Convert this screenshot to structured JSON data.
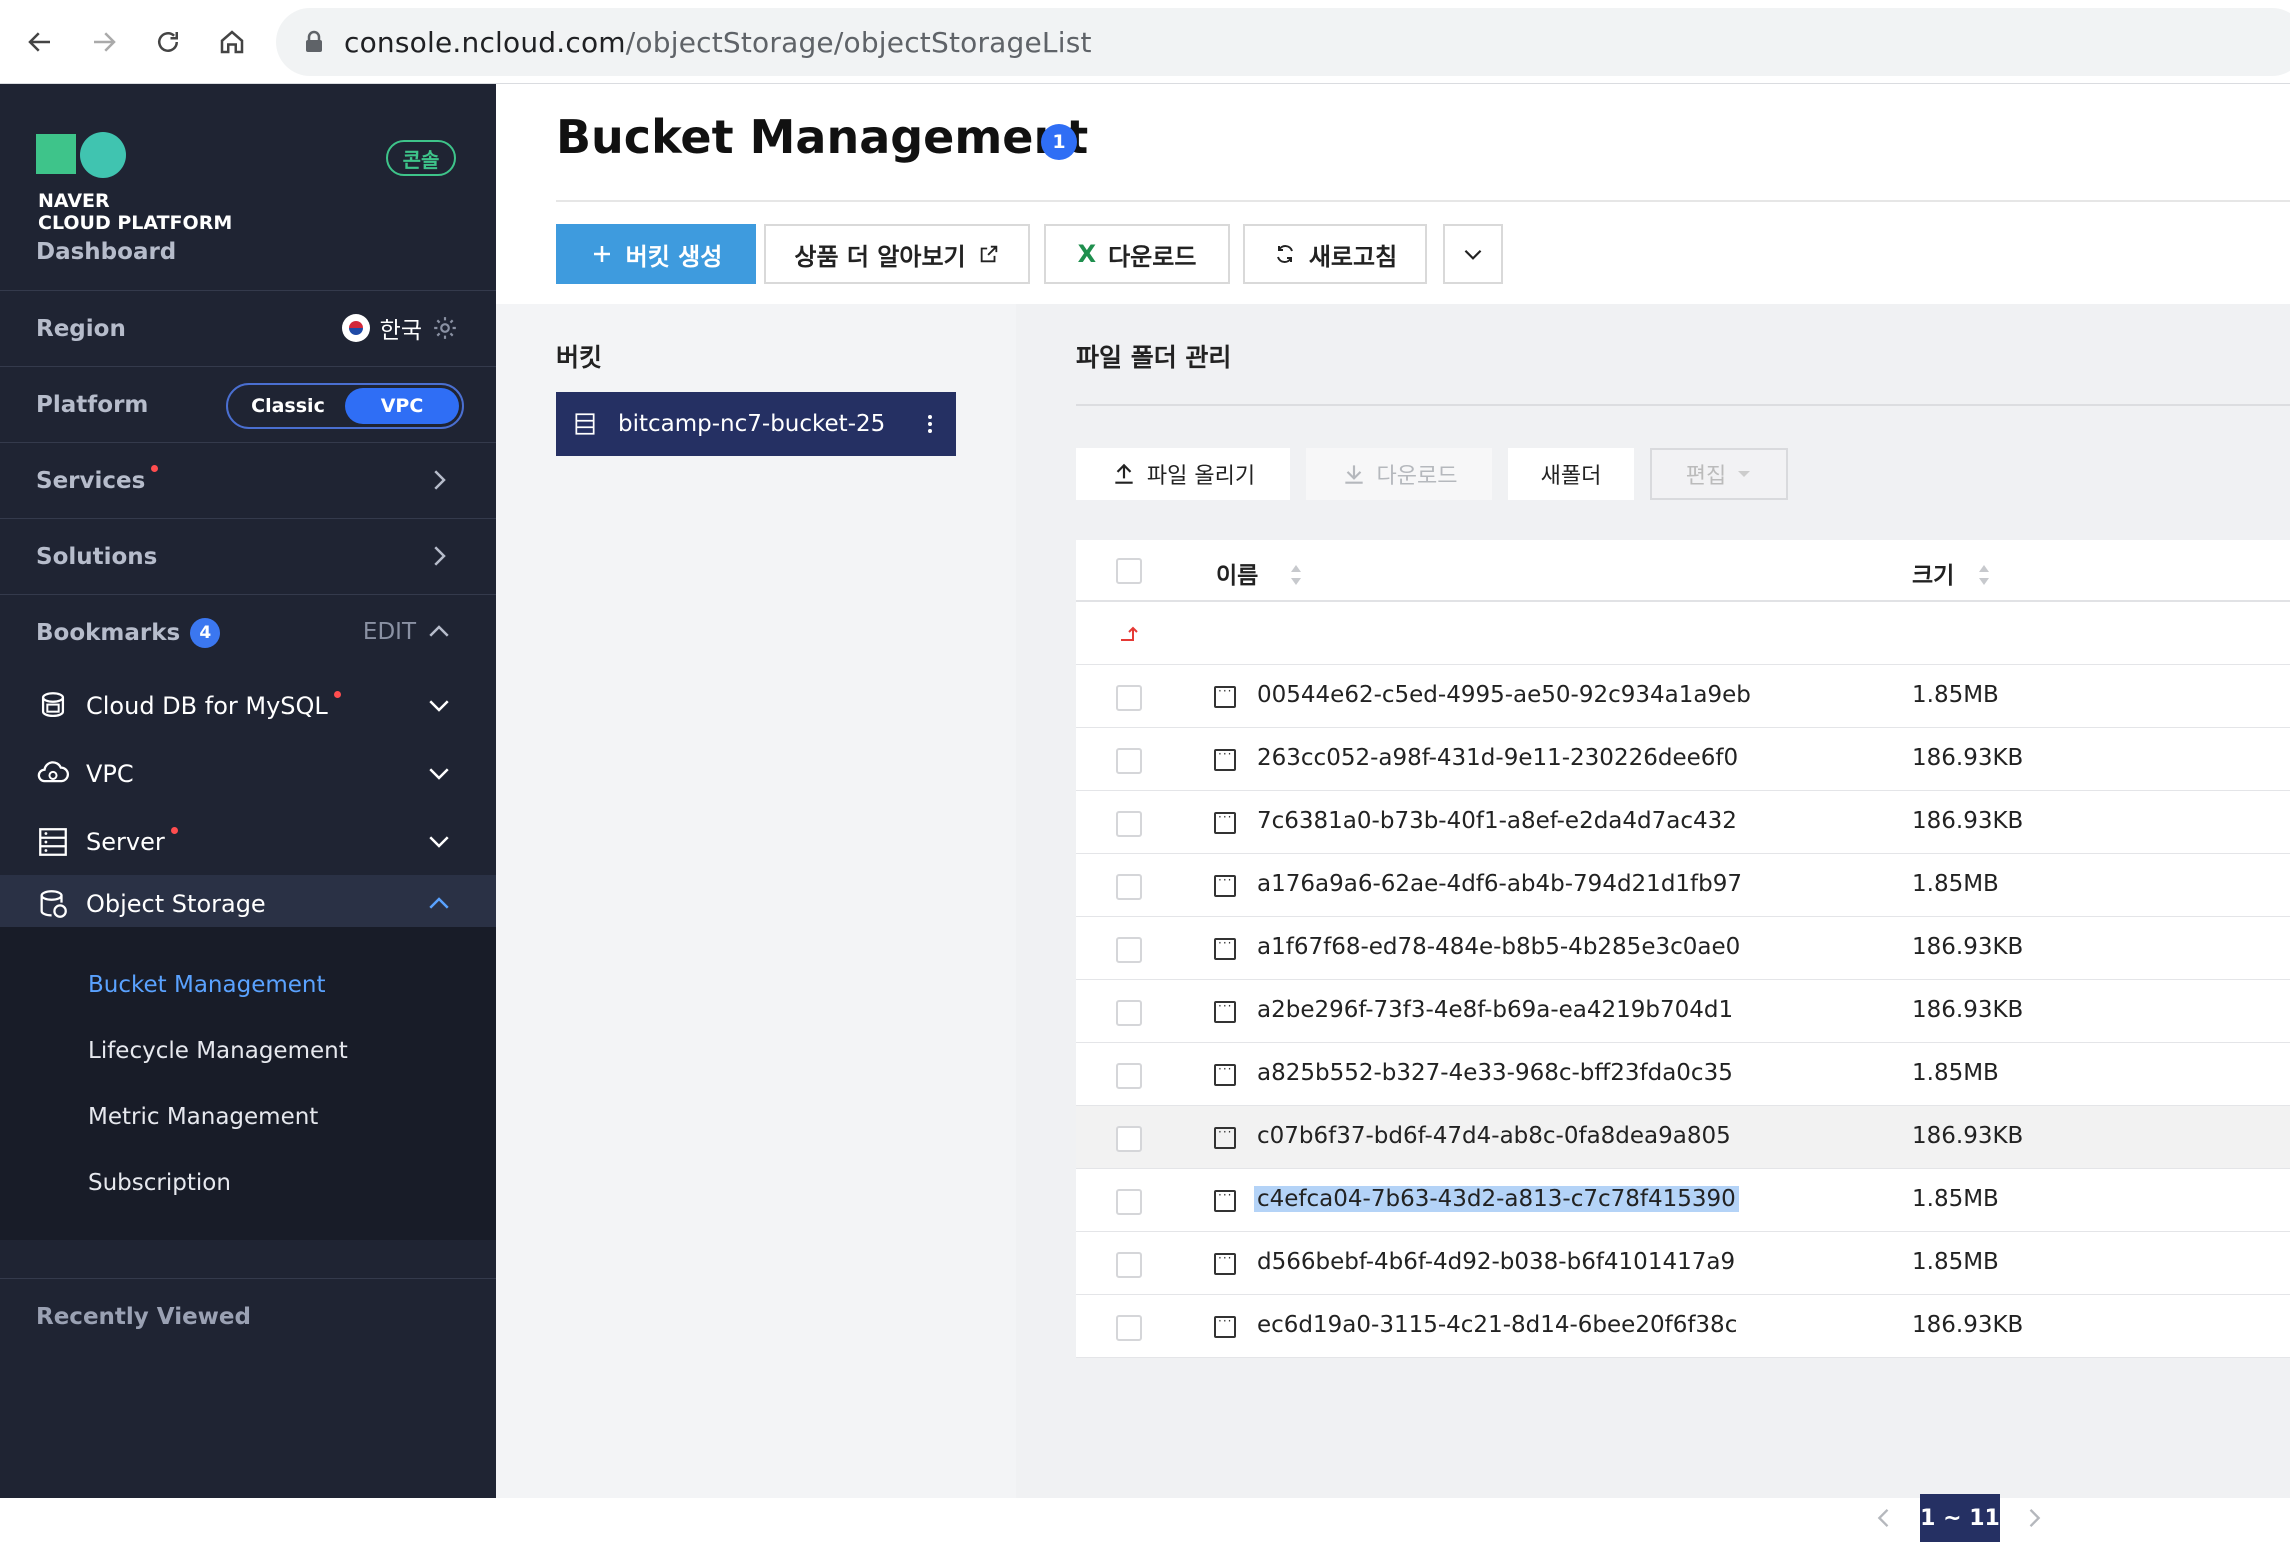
{
  "browser": {
    "url_domain": "console.ncloud.com",
    "url_path": "/objectStorage/objectStorageList"
  },
  "sidebar": {
    "logo_line1": "NAVER",
    "logo_line2": "CLOUD PLATFORM",
    "console_badge": "콘솔",
    "dashboard": "Dashboard",
    "region_label": "Region",
    "region_value": "한국",
    "platform_label": "Platform",
    "platform_options": [
      "Classic",
      "VPC"
    ],
    "services": "Services",
    "solutions": "Solutions",
    "bookmarks": "Bookmarks",
    "bookmarks_count": "4",
    "bookmarks_edit": "EDIT",
    "bookmark_items": [
      {
        "label": "Cloud DB for MySQL",
        "icon": "database-cloud-icon"
      },
      {
        "label": "VPC",
        "icon": "vpc-icon"
      },
      {
        "label": "Server",
        "icon": "server-icon"
      },
      {
        "label": "Object Storage",
        "icon": "object-storage-icon"
      }
    ],
    "object_storage_sub": [
      "Bucket Management",
      "Lifecycle Management",
      "Metric Management",
      "Subscription"
    ],
    "recently_viewed": "Recently Viewed"
  },
  "main": {
    "title": "Bucket Management",
    "title_badge": "1",
    "toolbar": {
      "create_bucket": "버킷 생성",
      "learn_more": "상품 더 알아보기",
      "download": "다운로드",
      "refresh": "새로고침"
    },
    "bucket_panel": {
      "title": "버킷",
      "bucket_name": "bitcamp-nc7-bucket-25"
    },
    "file_panel": {
      "title": "파일 폴더 관리",
      "upload": "파일 올리기",
      "download": "다운로드",
      "new_folder": "새폴더",
      "edit": "편집",
      "col_name": "이름",
      "col_size": "크기",
      "files": [
        {
          "name": "00544e62-c5ed-4995-ae50-92c934a1a9eb",
          "size": "1.85MB"
        },
        {
          "name": "263cc052-a98f-431d-9e11-230226dee6f0",
          "size": "186.93KB"
        },
        {
          "name": "7c6381a0-b73b-40f1-a8ef-e2da4d7ac432",
          "size": "186.93KB"
        },
        {
          "name": "a176a9a6-62ae-4df6-ab4b-794d21d1fb97",
          "size": "1.85MB"
        },
        {
          "name": "a1f67f68-ed78-484e-b8b5-4b285e3c0ae0",
          "size": "186.93KB"
        },
        {
          "name": "a2be296f-73f3-4e8f-b69a-ea4219b704d1",
          "size": "186.93KB"
        },
        {
          "name": "a825b552-b327-4e33-968c-bff23fda0c35",
          "size": "1.85MB"
        },
        {
          "name": "c07b6f37-bd6f-47d4-ab8c-0fa8dea9a805",
          "size": "186.93KB"
        },
        {
          "name": "c4efca04-7b63-43d2-a813-c7c78f415390",
          "size": "1.85MB"
        },
        {
          "name": "d566bebf-4b6f-4d92-b038-b6f4101417a9",
          "size": "1.85MB"
        },
        {
          "name": "ec6d19a0-3115-4c21-8d14-6bee20f6f38c",
          "size": "186.93KB"
        }
      ],
      "pagination": "1 ~ 11"
    }
  },
  "colors": {
    "sidebar_bg": "#1f2433",
    "accent_blue": "#2f6ef5",
    "primary_button": "#3e9bde",
    "selected_bucket": "#253063",
    "brand_green": "#3ec48a"
  }
}
